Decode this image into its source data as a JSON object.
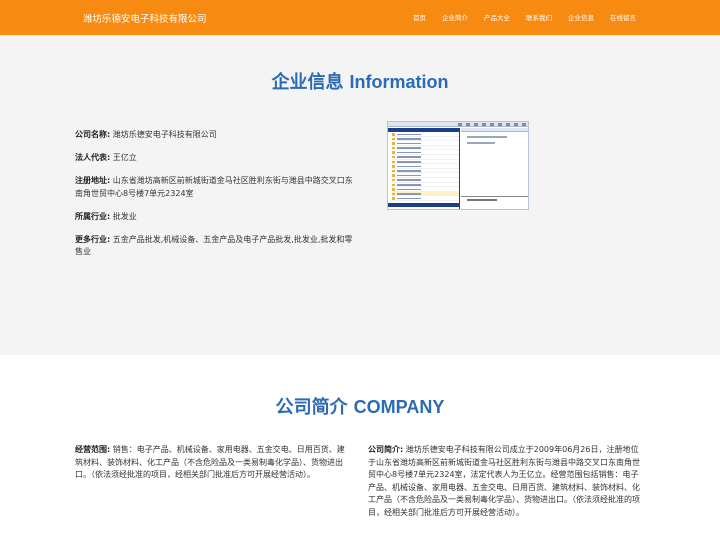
{
  "header": {
    "brand": "潍坊乐德安电子科技有限公司",
    "nav": [
      "首页",
      "企业简介",
      "产品大全",
      "联系我们",
      "企业信息",
      "在线留言"
    ]
  },
  "info_section": {
    "title_cn": "企业信息",
    "title_en": "Information",
    "rows": [
      {
        "label": "公司名称:",
        "value": "潍坊乐德安电子科技有限公司"
      },
      {
        "label": "法人代表:",
        "value": "王亿立"
      },
      {
        "label": "注册地址:",
        "value": "山东省潍坊高新区前新城街道金马社区胜利东街与潍县中路交叉口东南角世贸中心8号楼7单元2324室"
      },
      {
        "label": "所属行业:",
        "value": "批发业"
      },
      {
        "label": "更多行业:",
        "value": "五金产品批发,机械设备、五金产品及电子产品批发,批发业,批发和零售业"
      }
    ]
  },
  "company_section": {
    "title_cn": "公司简介",
    "title_en": "COMPANY",
    "scope_label": "经营范围:",
    "scope_text": "销售：电子产品、机械设备、家用电器、五金交电、日用百货、建筑材料、装饰材料、化工产品（不含危险品及一类易制毒化学品）、货物进出口。（依法须经批准的项目，经相关部门批准后方可开展经营活动）。",
    "intro_label": "公司简介:",
    "intro_text": "潍坊乐德安电子科技有限公司成立于2009年06月26日，注册地位于山东省潍坊高新区前新城街道金马社区胜利东街与潍县中路交叉口东南角世贸中心8号楼7单元2324室，法定代表人为王亿立。经营范围包括销售：电子产品、机械设备、家用电器、五金交电、日用百货、建筑材料、装饰材料、化工产品（不含危险品及一类易制毒化学品）、货物进出口。（依法须经批准的项目，经相关部门批准后方可开展经营活动）。"
  },
  "colors": {
    "header_bg": "#f78b12",
    "title_blue": "#2b6bb5",
    "section_bg": "#f4f4f4"
  }
}
